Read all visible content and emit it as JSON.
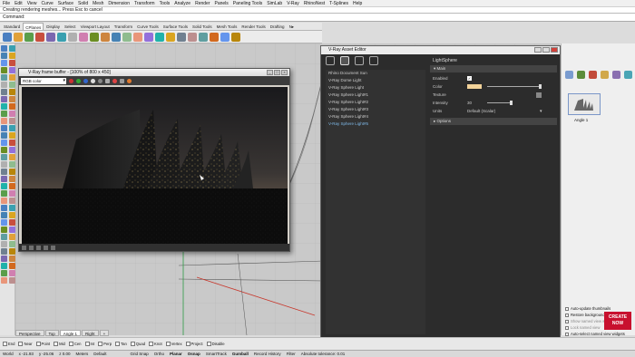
{
  "menubar": [
    "File",
    "Edit",
    "View",
    "Curve",
    "Surface",
    "Solid",
    "Mesh",
    "Dimension",
    "Transform",
    "Tools",
    "Analyze",
    "Render",
    "Panels",
    "Paneling Tools",
    "SimLab",
    "V-Ray",
    "RhinoNest",
    "T-Splines",
    "Help"
  ],
  "command": {
    "history": "Creating rendering meshes... Press Esc to cancel",
    "prompt": "Command:"
  },
  "toolbar_tabs": [
    "Standard",
    "CPlanes",
    "Display",
    "Select",
    "Viewport Layout",
    "Transform",
    "Curve Tools",
    "Surface Tools",
    "Solid Tools",
    "Mesh Tools",
    "Render Tools",
    "Drafting",
    "N▸"
  ],
  "active_toolbar_tab": "CPlanes",
  "frame_buffer": {
    "title": "V-Ray frame buffer - [100% of 800 x 450]",
    "channel": "RGB color"
  },
  "asset_editor": {
    "title": "V-Ray Asset Editor",
    "assets": [
      "Rhino Document Sun",
      "V-Ray Dome Light",
      "V-Ray Sphere Light",
      "V-Ray Sphere Light#1",
      "V-Ray Sphere Light#2",
      "V-Ray Sphere Light#3",
      "V-Ray Sphere Light#4",
      "V-Ray Sphere Light#5"
    ],
    "selected_index": 7,
    "properties": {
      "name": "LightSphere",
      "main_rollout": "Main",
      "enabled_label": "Enabled",
      "color_label": "Color",
      "texture_label": "Texture",
      "intensity_label": "Intensity",
      "intensity_value": "30",
      "units_label": "Units",
      "units_value": "Default (Scalar)",
      "options_rollout": "Options"
    }
  },
  "named_views": {
    "thumbnail_label": "Angle 1",
    "options": [
      "Auto-update thumbnails",
      "Restore background bitmap",
      "Show named view widget",
      "Lock named view",
      "Auto-select named view widgets"
    ]
  },
  "viewport_tabs": [
    "Perspective",
    "Top",
    "Angle 1",
    "Right",
    "+"
  ],
  "active_viewport_tab": "Angle 1",
  "osnap": [
    "End",
    "Near",
    "Point",
    "Mid",
    "Cen",
    "Int",
    "Perp",
    "Tan",
    "Quad",
    "Knot",
    "Vertex",
    "Project",
    "Disable"
  ],
  "status": {
    "cplane": "World",
    "x": "x -21.93",
    "y": "y -25.06",
    "z": "z 0.00",
    "units": "Meters",
    "layer": "Default",
    "items": [
      "Grid Snap",
      "Ortho",
      "Planar",
      "Osnap",
      "SmartTrack",
      "Gumball",
      "Record History",
      "Filter"
    ],
    "tolerance": "Absolute tolerance: 0.01"
  },
  "watermark": "CREATE NOW",
  "colors": {
    "vray_accent": "#6aa8e0",
    "light_color": "#f3d39a"
  }
}
